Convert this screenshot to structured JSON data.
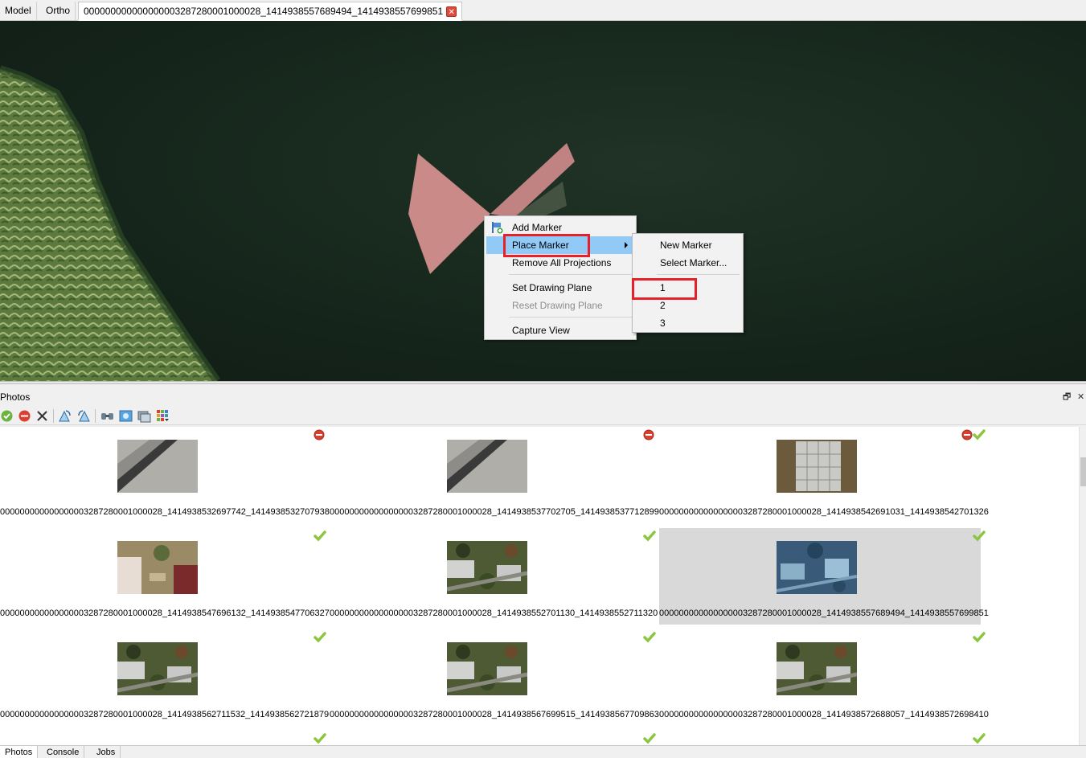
{
  "tabs": {
    "model": "Model",
    "ortho": "Ortho",
    "photo": "000000000000000003287280001000028_1414938557689494_1414938557699851",
    "close_glyph": "✕"
  },
  "context_menu": {
    "add_marker": "Add Marker",
    "place_marker": "Place Marker",
    "remove_all_projections": "Remove All Projections",
    "set_drawing_plane": "Set Drawing Plane",
    "reset_drawing_plane": "Reset Drawing Plane",
    "capture_view": "Capture View",
    "add_marker_icon": "marker-flag-icon"
  },
  "submenu": {
    "new_marker": "New Marker",
    "select_marker": "Select Marker...",
    "markers": [
      "1",
      "2",
      "3"
    ]
  },
  "photos_pane": {
    "title": "Photos",
    "restore_glyph": "🗗",
    "close_glyph": "✕",
    "toolbar_icons": [
      "enable-photos-icon",
      "disable-photos-icon",
      "remove-photos-icon",
      "rotate-right-icon",
      "rotate-left-icon",
      "filter-by-markers-icon",
      "view-photo-icon",
      "details-icon",
      "view-mode-icon"
    ]
  },
  "photos": [
    {
      "name": "000000000000000003287280001000028_1414938532697742_1414938532707938",
      "status": [
        "disabled"
      ],
      "kind": "pavement",
      "selected": false
    },
    {
      "name": "000000000000000003287280001000028_1414938537702705_1414938537712899",
      "status": [
        "disabled"
      ],
      "kind": "pavement",
      "selected": false
    },
    {
      "name": "000000000000000003287280001000028_1414938542691031_1414938542701326",
      "status": [
        "disabled",
        "aligned"
      ],
      "kind": "tiles",
      "selected": false
    },
    {
      "name": "000000000000000003287280001000028_1414938547696132_1414938547706327",
      "status": [
        "aligned"
      ],
      "kind": "aerial-light",
      "selected": false
    },
    {
      "name": "000000000000000003287280001000028_1414938552701130_1414938552711320",
      "status": [
        "aligned"
      ],
      "kind": "aerial",
      "selected": false
    },
    {
      "name": "000000000000000003287280001000028_1414938557689494_1414938557699851",
      "status": [
        "aligned"
      ],
      "kind": "aerial-blue",
      "selected": true
    },
    {
      "name": "000000000000000003287280001000028_1414938562711532_1414938562721879",
      "status": [
        "aligned"
      ],
      "kind": "aerial",
      "selected": false
    },
    {
      "name": "000000000000000003287280001000028_1414938567699515_1414938567709863",
      "status": [
        "aligned"
      ],
      "kind": "aerial",
      "selected": false
    },
    {
      "name": "000000000000000003287280001000028_1414938572688057_1414938572698410",
      "status": [
        "aligned"
      ],
      "kind": "aerial",
      "selected": false
    }
  ],
  "bottom_tabs": [
    "Photos",
    "Console",
    "Jobs"
  ],
  "colors": {
    "menu_highlight": "#91c9f7",
    "annotation_red": "#e8202a",
    "check_green": "#8cc63f",
    "disabled_red": "#d9402f"
  }
}
